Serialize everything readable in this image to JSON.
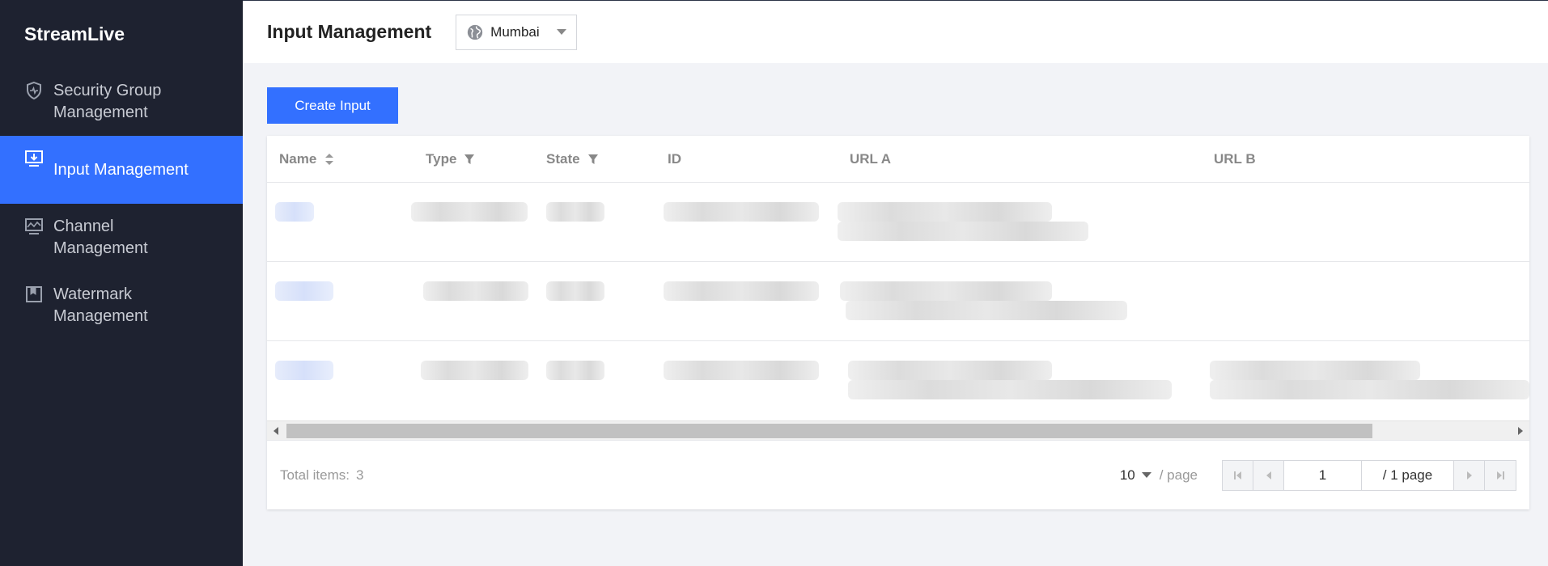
{
  "app": {
    "brand": "StreamLive"
  },
  "sidebar": {
    "items": [
      {
        "label": "Security Group Management",
        "icon": "shield-icon",
        "active": false
      },
      {
        "label": "Input Management",
        "icon": "input-download-icon",
        "active": true
      },
      {
        "label": "Channel Management",
        "icon": "monitor-wave-icon",
        "active": false
      },
      {
        "label": "Watermark Management",
        "icon": "bookmark-icon",
        "active": false
      }
    ]
  },
  "header": {
    "title": "Input Management",
    "region": {
      "value": "Mumbai",
      "icon": "globe-icon"
    }
  },
  "toolbar": {
    "create_label": "Create Input"
  },
  "table": {
    "columns": [
      "Name",
      "Type",
      "State",
      "ID",
      "URL A",
      "URL B"
    ]
  },
  "footer": {
    "total_label": "Total items:",
    "total_count": "3",
    "page_size": "10",
    "per_page_label": "/ page",
    "current_page": "1",
    "total_pages_label": "/ 1 page"
  },
  "colors": {
    "sidebar_bg": "#1e2230",
    "accent": "#3370ff",
    "page_bg": "#f2f3f7"
  }
}
